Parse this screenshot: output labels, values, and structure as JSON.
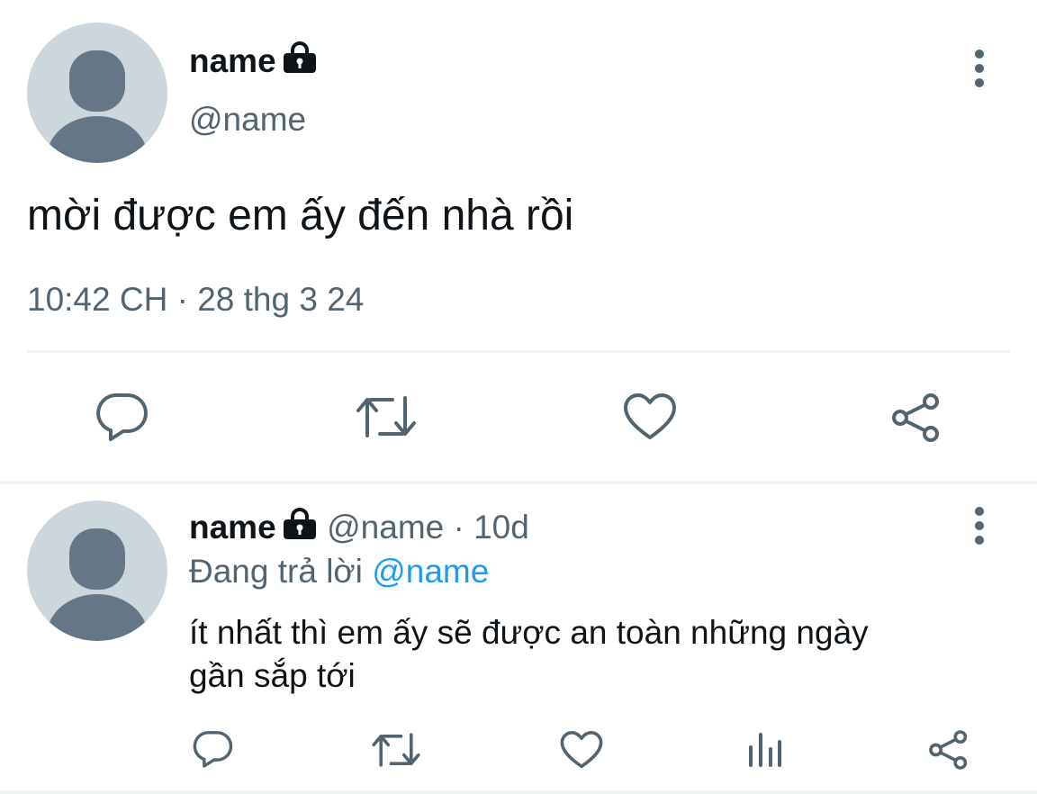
{
  "main_tweet": {
    "display_name": "name",
    "handle": "@name",
    "text": "mời được em ấy đến nhà rồi",
    "timestamp": "10:42 CH · 28 thg 3 24",
    "actions": [
      "comment-icon",
      "retweet-icon",
      "heart-icon",
      "share-icon"
    ]
  },
  "reply": {
    "display_name": "name",
    "handle_time": "@name · 10d",
    "replying_prefix": "Đang trả lời ",
    "replying_to": "@name",
    "text_line1": "ít nhất thì em ấy sẽ được an toàn những ngày",
    "text_line2": "gần sắp tới",
    "actions": [
      "comment-icon",
      "retweet-icon",
      "heart-icon",
      "analytics-icon",
      "share-icon"
    ]
  },
  "colors": {
    "text": "#0f1419",
    "secondary": "#536471",
    "link": "#1d9bf0",
    "avatar_bg": "#ccd6dd",
    "avatar_fg": "#657786",
    "divider": "#eff3f4"
  }
}
